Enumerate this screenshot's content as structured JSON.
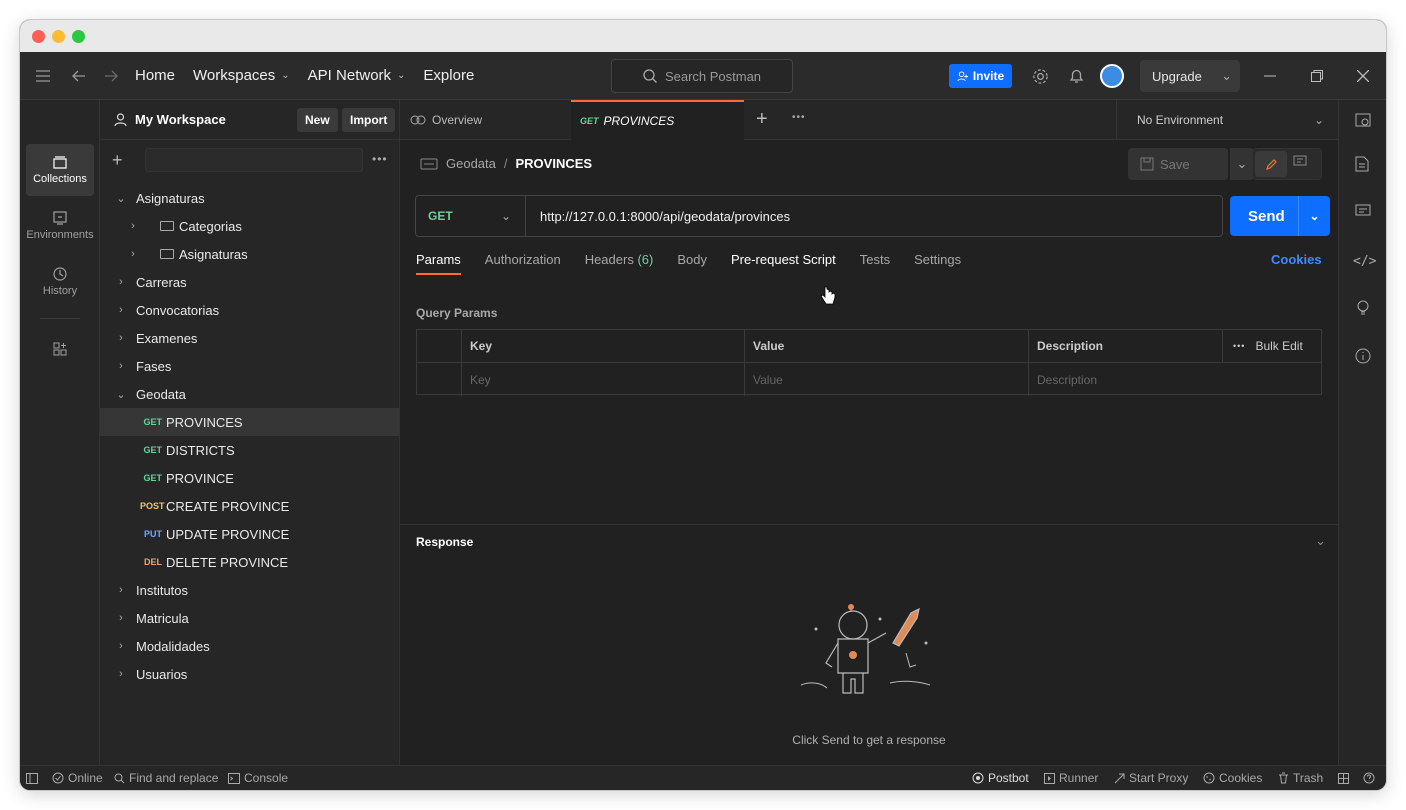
{
  "header": {
    "nav": {
      "home": "Home",
      "workspaces": "Workspaces",
      "api_network": "API Network",
      "explore": "Explore"
    },
    "search_placeholder": "Search Postman",
    "invite_label": "Invite",
    "upgrade_label": "Upgrade"
  },
  "rail": {
    "collections": "Collections",
    "environments": "Environments",
    "history": "History"
  },
  "sidebar": {
    "workspace_name": "My Workspace",
    "new_label": "New",
    "import_label": "Import",
    "tree": [
      {
        "label": "Asignaturas"
      },
      {
        "label": "Categorias"
      },
      {
        "label": "Asignaturas"
      },
      {
        "label": "Carreras"
      },
      {
        "label": "Convocatorias"
      },
      {
        "label": "Examenes"
      },
      {
        "label": "Fases"
      },
      {
        "label": "Geodata"
      },
      {
        "method": "GET",
        "label": "PROVINCES"
      },
      {
        "method": "GET",
        "label": "DISTRICTS"
      },
      {
        "method": "GET",
        "label": "PROVINCE"
      },
      {
        "method": "POST",
        "label": "CREATE PROVINCE"
      },
      {
        "method": "PUT",
        "label": "UPDATE PROVINCE"
      },
      {
        "method": "DEL",
        "label": "DELETE PROVINCE"
      },
      {
        "label": "Institutos"
      },
      {
        "label": "Matricula"
      },
      {
        "label": "Modalidades"
      },
      {
        "label": "Usuarios"
      }
    ]
  },
  "tabs": {
    "overview": "Overview",
    "active_method": "GET",
    "active_label": "PROVINCES",
    "environment": "No Environment"
  },
  "request": {
    "breadcrumb_parent": "Geodata",
    "breadcrumb_sep": "/",
    "breadcrumb_current": "PROVINCES",
    "save_label": "Save",
    "method": "GET",
    "url": "http://127.0.0.1:8000/api/geodata/provinces",
    "send_label": "Send",
    "tabs": {
      "params": "Params",
      "authorization": "Authorization",
      "headers": "Headers",
      "headers_count": "(6)",
      "body": "Body",
      "prerequest": "Pre-request Script",
      "tests": "Tests",
      "settings": "Settings"
    },
    "cookies_link": "Cookies",
    "query_title": "Query Params",
    "table": {
      "key": "Key",
      "value": "Value",
      "description": "Description",
      "bulk_edit": "Bulk Edit",
      "ph_key": "Key",
      "ph_value": "Value",
      "ph_description": "Description"
    }
  },
  "response": {
    "title": "Response",
    "empty_text": "Click Send to get a response"
  },
  "statusbar": {
    "online": "Online",
    "find": "Find and replace",
    "console": "Console",
    "postbot": "Postbot",
    "runner": "Runner",
    "proxy": "Start Proxy",
    "cookies": "Cookies",
    "trash": "Trash"
  }
}
